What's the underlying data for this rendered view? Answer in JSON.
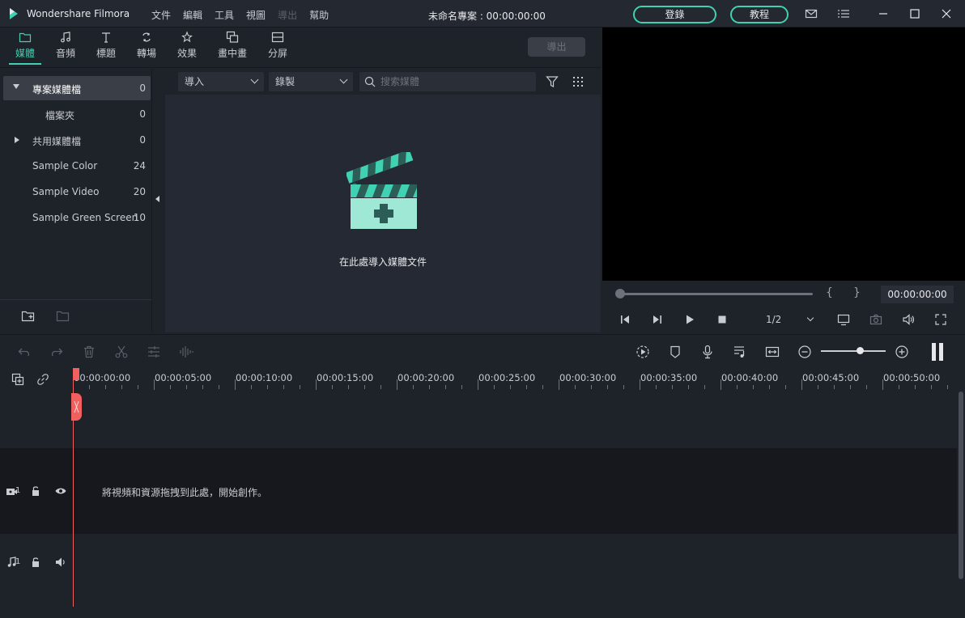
{
  "titlebar": {
    "app_name": "Wondershare Filmora",
    "menu": [
      "文件",
      "編輯",
      "工具",
      "視圖",
      "導出",
      "幫助"
    ],
    "menu_disabled_index": 4,
    "doc_title": "未命名專案 : 00:00:00:00",
    "login_label": "登錄",
    "tutorial_label": "教程",
    "accent_color": "#3fd1b1"
  },
  "tabs": [
    {
      "label": "媒體",
      "icon": "folder-icon",
      "active": true
    },
    {
      "label": "音頻",
      "icon": "music-note-icon",
      "active": false
    },
    {
      "label": "標題",
      "icon": "text-t-icon",
      "active": false
    },
    {
      "label": "轉場",
      "icon": "transition-icon",
      "active": false
    },
    {
      "label": "效果",
      "icon": "effects-icon",
      "active": false
    },
    {
      "label": "畫中畫",
      "icon": "pip-icon",
      "active": false
    },
    {
      "label": "分屏",
      "icon": "split-screen-icon",
      "active": false
    }
  ],
  "export_label": "導出",
  "sidebar": {
    "items": [
      {
        "label": "專案媒體檔",
        "count": "0",
        "arrow": "down",
        "selected": true
      },
      {
        "label": "檔案夾",
        "count": "0",
        "arrow": "none",
        "selected": false
      },
      {
        "label": "共用媒體檔",
        "count": "0",
        "arrow": "right",
        "selected": false
      },
      {
        "label": "Sample Color",
        "count": "24",
        "arrow": "none",
        "selected": false
      },
      {
        "label": "Sample Video",
        "count": "20",
        "arrow": "none",
        "selected": false
      },
      {
        "label": "Sample Green Screen",
        "count": "10",
        "arrow": "none",
        "selected": false
      }
    ]
  },
  "media": {
    "import_label": "導入",
    "record_label": "錄製",
    "search_placeholder": "搜索媒體",
    "empty_label": "在此處導入媒體文件"
  },
  "preview": {
    "timecode": "00:00:00:00",
    "left_brace": "{",
    "right_brace": "}",
    "ratio": "1/2",
    "progress": 0
  },
  "timeline": {
    "ticks": [
      "00:00:00:00",
      "00:00:05:00",
      "00:00:10:00",
      "00:00:15:00",
      "00:00:20:00",
      "00:00:25:00",
      "00:00:30:00",
      "00:00:35:00",
      "00:00:40:00",
      "00:00:45:00",
      "00:00:50:00"
    ],
    "video_track_num": "1",
    "audio_track_num": "1",
    "drop_hint": "將視頻和資源拖拽到此處，開始創作。",
    "zoom_level": 0.6,
    "playhead_color": "#f15f5f"
  }
}
